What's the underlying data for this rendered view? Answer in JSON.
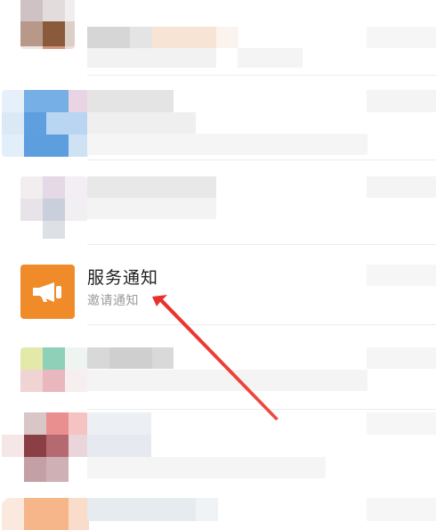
{
  "chat_list": {
    "highlighted_item": {
      "name": "服务通知",
      "subtitle": "邀请通知",
      "icon": "megaphone-icon",
      "icon_color": "#f08b2a"
    },
    "annotation": {
      "type": "arrow",
      "color": "#e8302a"
    }
  }
}
